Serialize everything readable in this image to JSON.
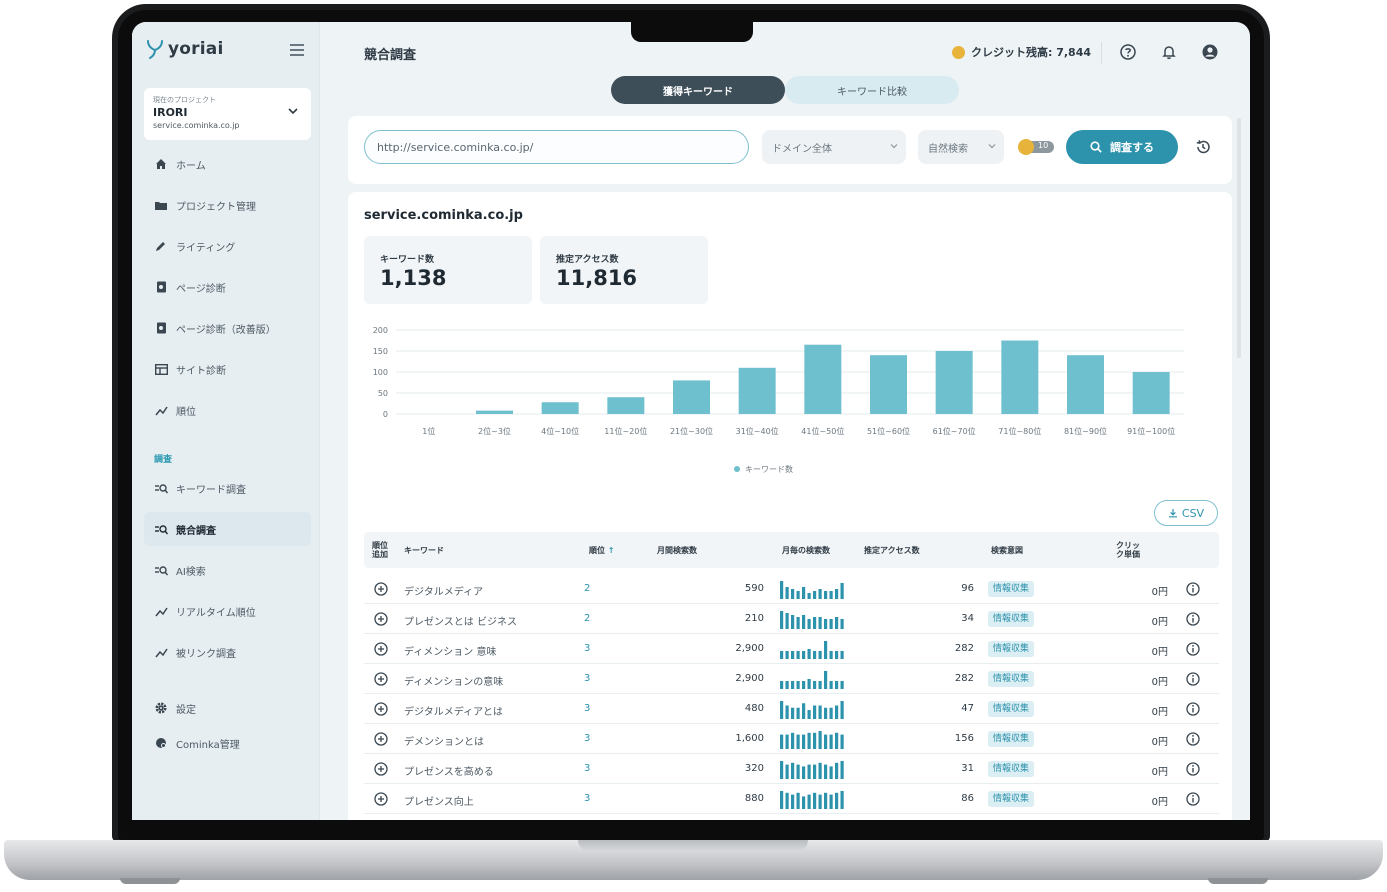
{
  "brand": {
    "name": "yoriai",
    "accent": "#2d93ad",
    "dark_tab": "#3d4e59",
    "coin": "#e8b33a"
  },
  "sidebar": {
    "project": {
      "caption": "現在のプロジェクト",
      "name": "IRORI",
      "url": "service.cominka.co.jp"
    },
    "items": [
      {
        "label": "ホーム",
        "icon": "home-icon"
      },
      {
        "label": "プロジェクト管理",
        "icon": "folder-icon"
      },
      {
        "label": "ライティング",
        "icon": "pencil-icon"
      },
      {
        "label": "ページ診断",
        "icon": "page-scan-icon"
      },
      {
        "label": "ページ診断（改善版）",
        "icon": "page-scan-icon"
      },
      {
        "label": "サイト診断",
        "icon": "site-icon"
      },
      {
        "label": "順位",
        "icon": "rank-chart-icon"
      }
    ],
    "section": "調査",
    "research_items": [
      {
        "label": "キーワード調査",
        "icon": "keyword-search-icon"
      },
      {
        "label": "競合調査",
        "icon": "keyword-search-icon",
        "active": true
      },
      {
        "label": "AI検索",
        "icon": "keyword-search-icon"
      },
      {
        "label": "リアルタイム順位",
        "icon": "rank-chart-icon"
      },
      {
        "label": "被リンク調査",
        "icon": "rank-chart-icon"
      }
    ],
    "footer_items": [
      {
        "label": "設定",
        "icon": "gear-icon"
      },
      {
        "label": "Cominka管理",
        "icon": "admin-icon"
      }
    ]
  },
  "header": {
    "title": "競合調査",
    "credit": "クレジット残高: 7,844"
  },
  "tabs": [
    "獲得キーワード",
    "キーワード比較"
  ],
  "search": {
    "url_value": "http://service.cominka.co.jp/",
    "scope": "ドメイン全体",
    "type": "自然検索",
    "toggle_value": "10",
    "button": "調査する"
  },
  "result": {
    "domain": "service.cominka.co.jp",
    "stats": [
      {
        "label": "キーワード数",
        "value": "1,138"
      },
      {
        "label": "推定アクセス数",
        "value": "11,816"
      }
    ],
    "csv_label": "CSV"
  },
  "chart_data": {
    "type": "bar",
    "categories": [
      "1位",
      "2位~3位",
      "4位~10位",
      "11位~20位",
      "21位~30位",
      "31位~40位",
      "41位~50位",
      "51位~60位",
      "61位~70位",
      "71位~80位",
      "81位~90位",
      "91位~100位"
    ],
    "series": [
      {
        "name": "キーワード数",
        "values": [
          0,
          8,
          28,
          40,
          80,
          110,
          165,
          140,
          150,
          175,
          140,
          100
        ]
      }
    ],
    "yticks": [
      "0",
      "50",
      "100",
      "150",
      "200"
    ],
    "ylim": [
      0,
      200
    ],
    "legend": "bottom",
    "grid": true,
    "bar_color": "#6fc0cf"
  },
  "table": {
    "headers": {
      "add": "順位追加",
      "keyword": "キーワード",
      "rank": "順位",
      "volume": "月間検索数",
      "monthly": "月毎の検索数",
      "access": "推定アクセス数",
      "intent": "検索意図",
      "cpc": "クリック単価"
    },
    "rows": [
      {
        "keyword": "デジタルメディア",
        "rank": "2",
        "volume": "590",
        "access": "96",
        "intent": "情報収集",
        "cpc": "0円",
        "spark": [
          9,
          6,
          5,
          4,
          6,
          3,
          4,
          5,
          4,
          4,
          5,
          8
        ]
      },
      {
        "keyword": "プレゼンスとは ビジネス",
        "rank": "2",
        "volume": "210",
        "access": "34",
        "intent": "情報収集",
        "cpc": "0円",
        "spark": [
          9,
          8,
          7,
          6,
          7,
          5,
          6,
          6,
          5,
          5,
          6,
          5
        ]
      },
      {
        "keyword": "ディメンション 意味",
        "rank": "3",
        "volume": "2,900",
        "access": "282",
        "intent": "情報収集",
        "cpc": "0円",
        "spark": [
          4,
          4,
          4,
          4,
          4,
          5,
          4,
          4,
          9,
          4,
          4,
          4
        ]
      },
      {
        "keyword": "ディメンションの意味",
        "rank": "3",
        "volume": "2,900",
        "access": "282",
        "intent": "情報収集",
        "cpc": "0円",
        "spark": [
          4,
          4,
          4,
          4,
          4,
          5,
          4,
          4,
          9,
          4,
          4,
          4
        ]
      },
      {
        "keyword": "デジタルメディアとは",
        "rank": "3",
        "volume": "480",
        "access": "47",
        "intent": "情報収集",
        "cpc": "0円",
        "spark": [
          8,
          6,
          5,
          5,
          7,
          4,
          6,
          6,
          5,
          5,
          6,
          8
        ]
      },
      {
        "keyword": "デメンションとは",
        "rank": "3",
        "volume": "1,600",
        "access": "156",
        "intent": "情報収集",
        "cpc": "0円",
        "spark": [
          8,
          8,
          9,
          8,
          8,
          9,
          9,
          10,
          8,
          8,
          9,
          8
        ]
      },
      {
        "keyword": "プレゼンスを高める",
        "rank": "3",
        "volume": "320",
        "access": "31",
        "intent": "情報収集",
        "cpc": "0円",
        "spark": [
          10,
          8,
          9,
          8,
          7,
          8,
          8,
          9,
          8,
          7,
          9,
          10
        ]
      },
      {
        "keyword": "プレゼンス向上",
        "rank": "3",
        "volume": "880",
        "access": "86",
        "intent": "情報収集",
        "cpc": "0円",
        "spark": [
          10,
          9,
          8,
          9,
          7,
          8,
          9,
          8,
          9,
          8,
          9,
          10
        ]
      }
    ]
  }
}
